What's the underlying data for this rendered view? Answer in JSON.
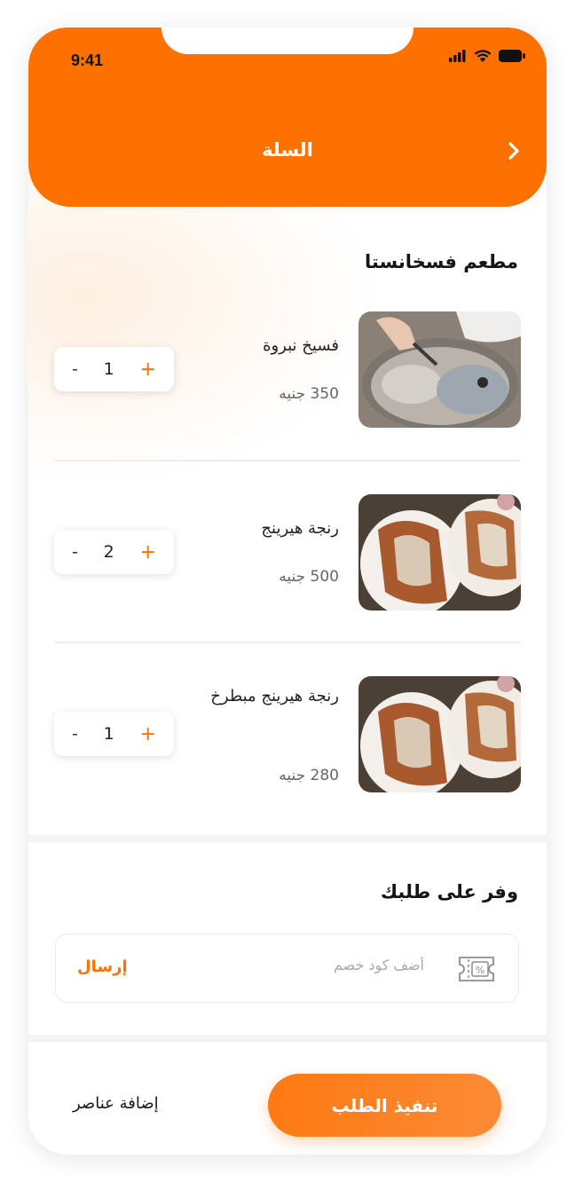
{
  "status_bar": {
    "time": "9:41"
  },
  "header": {
    "title": "السلة"
  },
  "restaurant": {
    "name": "مطعم فسخانستا"
  },
  "cart": {
    "items": [
      {
        "name": "فسيخ نبروة",
        "price": "350 جنيه",
        "qty": "1"
      },
      {
        "name": "رنجة هيرينج",
        "price": "500 جنيه",
        "qty": "2"
      },
      {
        "name": "رنجة هيرينج مبطرخ",
        "price": "280 جنيه",
        "qty": "1"
      }
    ],
    "minus_label": "-",
    "plus_label": "+"
  },
  "coupon": {
    "title": "وفر على طلبك",
    "placeholder": "أضف كود خصم",
    "send_label": "إرسال"
  },
  "footer": {
    "checkout_label": "تنفيذ الطلب",
    "add_items_label": "إضافة عناصر"
  },
  "colors": {
    "accent": "#fe7100"
  }
}
